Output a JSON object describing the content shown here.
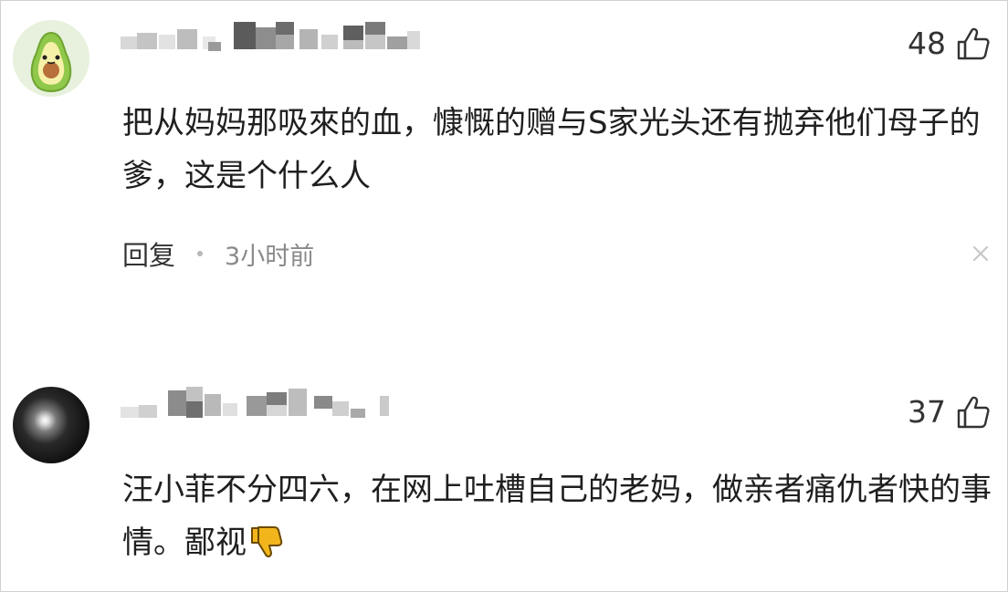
{
  "comments": [
    {
      "username_display": "",
      "avatar_icon": "avocado-avatar-icon",
      "likes": "48",
      "like_icon": "thumbs-up-outline-icon",
      "text": "把从妈妈那吸來的血，慷慨的赠与S家光头还有抛弃他们母子的爹，这是个什么人",
      "reply_label": "回复",
      "time": "3小时前",
      "close_icon": "close-icon"
    },
    {
      "username_display": "",
      "avatar_icon": "dark-orb-avatar-icon",
      "likes": "37",
      "like_icon": "thumbs-up-outline-icon",
      "text": "汪小菲不分四六，在网上吐槽自己的老妈，做亲者痛仇者快的事情。鄙视",
      "emoji": "thumbs-down-emoji-icon"
    }
  ],
  "colors": {
    "background": "#ffffff",
    "text": "#1f1f1f",
    "muted": "#8a8a8a",
    "emoji_yellow": "#f2b61c"
  }
}
